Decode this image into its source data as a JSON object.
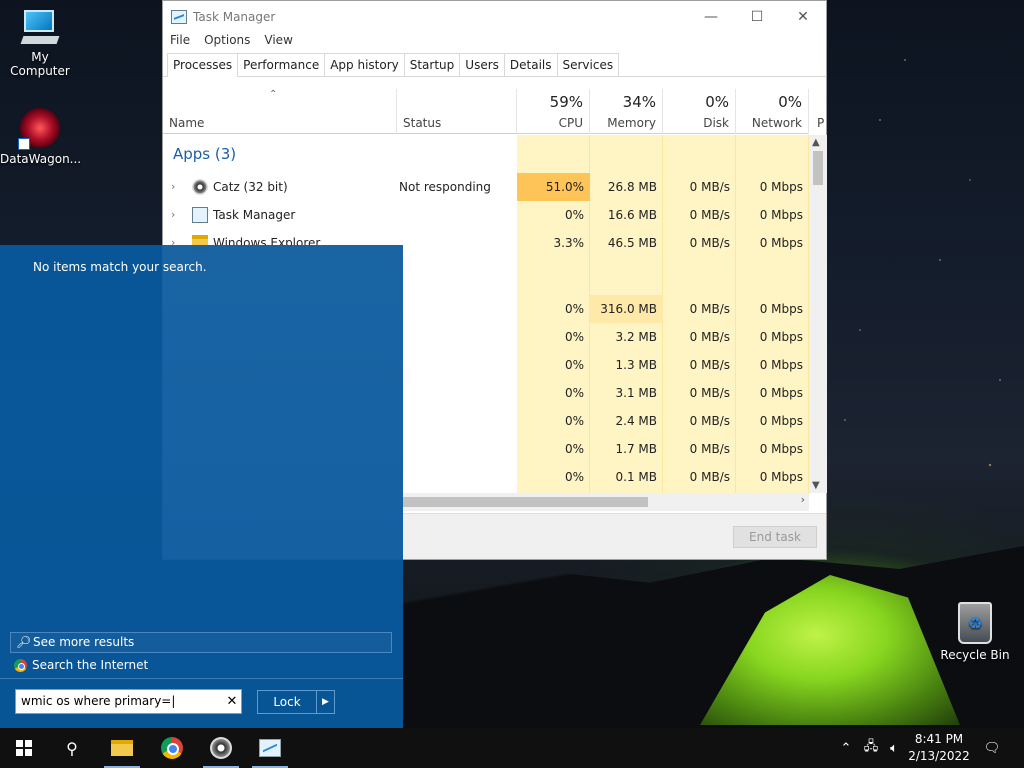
{
  "desktop": {
    "icons": [
      {
        "label": "My Computer",
        "icon": "computer-icon"
      },
      {
        "label": "DataWagon...",
        "icon": "datawagon-shortcut-icon"
      },
      {
        "label": "Recycle Bin",
        "icon": "recycle-bin-icon"
      }
    ]
  },
  "taskmanager": {
    "title": "Task Manager",
    "menu": [
      "File",
      "Options",
      "View"
    ],
    "tabs": [
      "Processes",
      "Performance",
      "App history",
      "Startup",
      "Users",
      "Details",
      "Services"
    ],
    "active_tab": "Processes",
    "columns": {
      "name": "Name",
      "status": "Status",
      "cpu": {
        "pct": "59%",
        "label": "CPU"
      },
      "memory": {
        "pct": "34%",
        "label": "Memory"
      },
      "disk": {
        "pct": "0%",
        "label": "Disk"
      },
      "network": {
        "pct": "0%",
        "label": "Network"
      },
      "extra": "P"
    },
    "group_label": "Apps (3)",
    "apps": [
      {
        "name": "Catz (32 bit)",
        "status": "Not responding",
        "cpu": "51.0%",
        "memory": "26.8 MB",
        "disk": "0 MB/s",
        "network": "0 Mbps",
        "icon": "catz-icon"
      },
      {
        "name": "Task Manager",
        "status": "",
        "cpu": "0%",
        "memory": "16.6 MB",
        "disk": "0 MB/s",
        "network": "0 Mbps",
        "icon": "task-manager-icon"
      },
      {
        "name": "Windows Explorer",
        "status": "",
        "cpu": "3.3%",
        "memory": "46.5 MB",
        "disk": "0 MB/s",
        "network": "0 Mbps",
        "icon": "folder-icon"
      }
    ],
    "background": [
      {
        "cpu": "0%",
        "memory": "316.0 MB",
        "disk": "0 MB/s",
        "network": "0 Mbps"
      },
      {
        "cpu": "0%",
        "memory": "3.2 MB",
        "disk": "0 MB/s",
        "network": "0 Mbps"
      },
      {
        "cpu": "0%",
        "memory": "1.3 MB",
        "disk": "0 MB/s",
        "network": "0 Mbps"
      },
      {
        "cpu": "0%",
        "memory": "3.1 MB",
        "disk": "0 MB/s",
        "network": "0 Mbps"
      },
      {
        "cpu": "0%",
        "memory": "2.4 MB",
        "disk": "0 MB/s",
        "network": "0 Mbps"
      },
      {
        "cpu": "0%",
        "memory": "1.7 MB",
        "disk": "0 MB/s",
        "network": "0 Mbps"
      },
      {
        "cpu": "0%",
        "memory": "0.1 MB",
        "disk": "0 MB/s",
        "network": "0 Mbps"
      }
    ],
    "end_task": "End task"
  },
  "search": {
    "no_items": "No items match your search.",
    "see_more": "See more results",
    "search_internet": "Search the Internet",
    "query": "wmic os where primary=|",
    "lock_label": "Lock"
  },
  "taskbar": {
    "items": [
      "start-icon",
      "search-icon",
      "file-explorer-icon",
      "chrome-icon",
      "catz-icon",
      "task-manager-icon"
    ],
    "time": "8:41 PM",
    "date": "2/13/2022"
  }
}
